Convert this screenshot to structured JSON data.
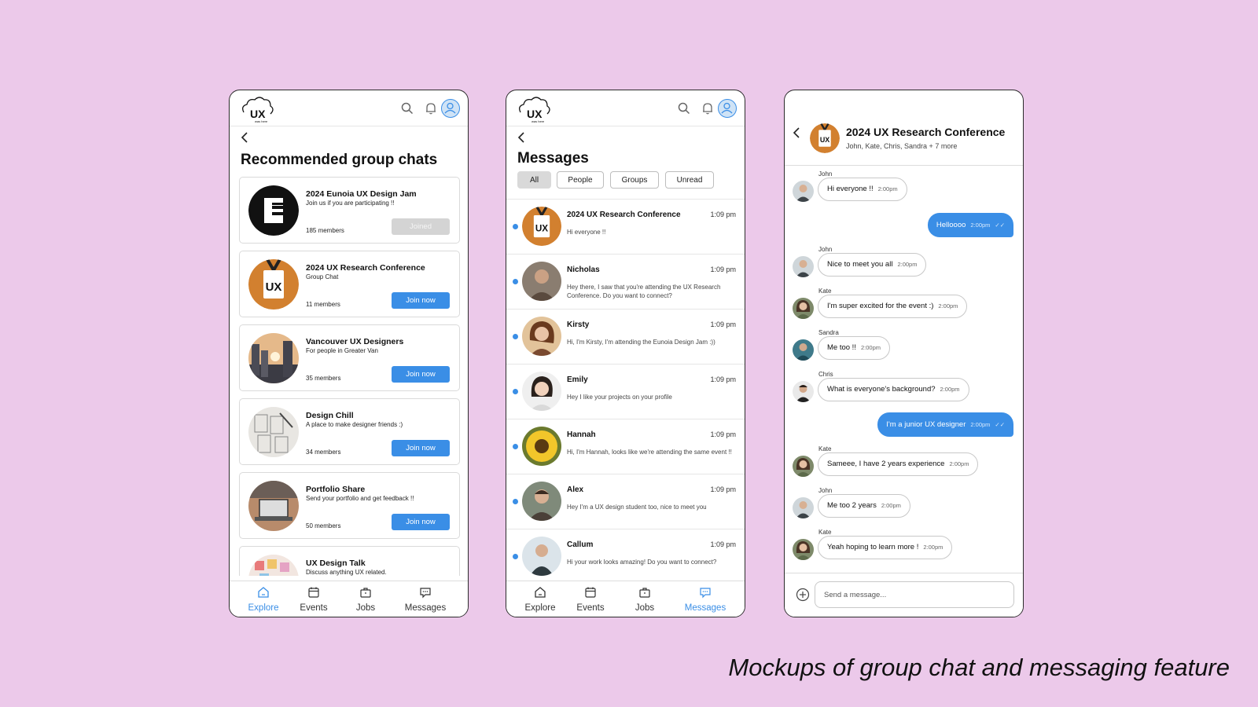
{
  "caption": "Mockups of group chat and messaging feature",
  "colors": {
    "background": "#ecc9ea",
    "accent": "#3a8ee6",
    "joined": "#d4d4d4"
  },
  "logo": {
    "text": "UX",
    "tagline": "was here"
  },
  "nav": {
    "explore": "Explore",
    "events": "Events",
    "jobs": "Jobs",
    "messages": "Messages"
  },
  "explore_screen": {
    "title": "Recommended group chats",
    "groups": [
      {
        "name": "2024 Eunoia UX Design Jam",
        "desc": "Join us if you are participating !!",
        "members": "185 members",
        "button": "Joined",
        "joined": true,
        "icon": "eunoia-logo-icon"
      },
      {
        "name": "2024 UX Research Conference",
        "desc": "Group Chat",
        "members": "11 members",
        "button": "Join now",
        "joined": false,
        "icon": "ux-conference-badge-icon"
      },
      {
        "name": "Vancouver UX Designers",
        "desc": "For people in Greater Van",
        "members": "35 members",
        "button": "Join now",
        "joined": false,
        "icon": "city-skyline-photo"
      },
      {
        "name": "Design Chill",
        "desc": "A place to make designer friends :)",
        "members": "34 members",
        "button": "Join now",
        "joined": false,
        "icon": "wireframe-sketch-photo"
      },
      {
        "name": "Portfolio Share",
        "desc": "Send your portfolio and get feedback !!",
        "members": "50 members",
        "button": "Join now",
        "joined": false,
        "icon": "laptop-photo"
      },
      {
        "name": "UX Design Talk",
        "desc": "Discuss anything UX related.",
        "members": "",
        "button": "",
        "joined": false,
        "icon": "sticky-notes-photo"
      }
    ]
  },
  "messages_screen": {
    "title": "Messages",
    "filters": [
      "All",
      "People",
      "Groups",
      "Unread"
    ],
    "active_filter": "All",
    "conversations": [
      {
        "name": "2024 UX Research Conference",
        "time": "1:09 pm",
        "text": "Hi everyone !!",
        "unread": true
      },
      {
        "name": "Nicholas",
        "time": "1:09 pm",
        "text": "Hey there, I saw that you're attending the UX Research Conference.  Do you want to connect?",
        "unread": true
      },
      {
        "name": "Kirsty",
        "time": "1:09 pm",
        "text": "Hi, I'm Kirsty, I'm attending the Eunoia Design Jam :))",
        "unread": true
      },
      {
        "name": "Emily",
        "time": "1:09 pm",
        "text": "Hey I like your projects on your profile",
        "unread": true
      },
      {
        "name": "Hannah",
        "time": "1:09 pm",
        "text": "Hi, I'm Hannah, looks like we're attending the same event !!",
        "unread": true
      },
      {
        "name": "Alex",
        "time": "1:09 pm",
        "text": "Hey I'm a UX design student too, nice to meet you",
        "unread": true
      },
      {
        "name": "Callum",
        "time": "1:09 pm",
        "text": "Hi your work looks amazing! Do you want to connect?",
        "unread": true
      }
    ]
  },
  "chat_screen": {
    "title": "2024 UX Research Conference",
    "participants": "John, Kate, Chris, Sandra + 7 more",
    "messages": [
      {
        "sender": "John",
        "text": "Hi everyone !!",
        "time": "2:00pm",
        "own": false
      },
      {
        "sender": "",
        "text": "Helloooo",
        "time": "2:00pm",
        "own": true,
        "read": "✓✓"
      },
      {
        "sender": "John",
        "text": "Nice to meet you all",
        "time": "2:00pm",
        "own": false
      },
      {
        "sender": "Kate",
        "text": "I'm super excited for the event :)",
        "time": "2:00pm",
        "own": false
      },
      {
        "sender": "Sandra",
        "text": "Me too !!",
        "time": "2:00pm",
        "own": false
      },
      {
        "sender": "Chris",
        "text": "What is everyone's background?",
        "time": "2:00pm",
        "own": false
      },
      {
        "sender": "",
        "text": "I'm a junior UX designer",
        "time": "2:00pm",
        "own": true,
        "read": "✓✓"
      },
      {
        "sender": "Kate",
        "text": "Sameee, I have 2 years experience",
        "time": "2:00pm",
        "own": false
      },
      {
        "sender": "John",
        "text": "Me too 2 years",
        "time": "2:00pm",
        "own": false
      },
      {
        "sender": "Kate",
        "text": "Yeah hoping to learn more !",
        "time": "2:00pm",
        "own": false
      }
    ],
    "input_placeholder": "Send a message..."
  }
}
